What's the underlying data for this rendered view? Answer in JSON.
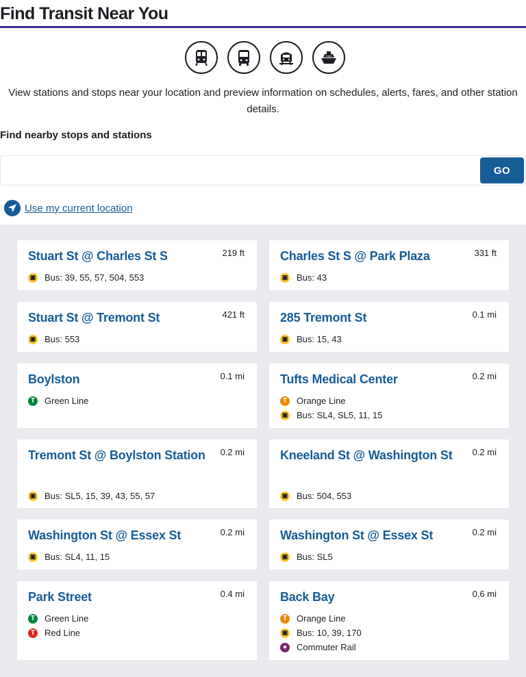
{
  "header": {
    "title": "Find Transit Near You"
  },
  "modes": [
    {
      "icon": "subway-icon"
    },
    {
      "icon": "bus-icon"
    },
    {
      "icon": "commuter-rail-icon"
    },
    {
      "icon": "ferry-icon"
    }
  ],
  "intro_text": "View stations and stops near your location and preview information on schedules, alerts, fares, and other station details.",
  "search": {
    "label": "Find nearby stops and stations",
    "value": "",
    "placeholder": "",
    "button_label": "GO"
  },
  "location_link": "Use my current location",
  "colors": {
    "accent": "#165c96",
    "rule": "#3b2f8f",
    "bus": "#ffc72c",
    "green_line": "#00843d",
    "orange_line": "#ed8b00",
    "red_line": "#da291c",
    "commuter_rail": "#80276c"
  },
  "stops": [
    {
      "name": "Stuart St @ Charles St S",
      "distance": "219 ft",
      "routes": [
        {
          "type": "bus",
          "label": "Bus: 39, 55, 57, 504, 553"
        }
      ]
    },
    {
      "name": "Charles St S @ Park Plaza",
      "distance": "331 ft",
      "routes": [
        {
          "type": "bus",
          "label": "Bus: 43"
        }
      ]
    },
    {
      "name": "Stuart St @ Tremont St",
      "distance": "421 ft",
      "routes": [
        {
          "type": "bus",
          "label": "Bus: 553"
        }
      ]
    },
    {
      "name": "285 Tremont St",
      "distance": "0.1 mi",
      "routes": [
        {
          "type": "bus",
          "label": "Bus: 15, 43"
        }
      ]
    },
    {
      "name": "Boylston",
      "distance": "0.1 mi",
      "routes": [
        {
          "type": "green",
          "label": "Green Line"
        }
      ]
    },
    {
      "name": "Tufts Medical Center",
      "distance": "0.2 mi",
      "routes": [
        {
          "type": "orange",
          "label": "Orange Line"
        },
        {
          "type": "bus",
          "label": "Bus: SL4, SL5, 11, 15"
        }
      ]
    },
    {
      "name": "Tremont St @ Boylston Station",
      "distance": "0.2 mi",
      "routes": [
        {
          "type": "bus",
          "label": "Bus: SL5, 15, 39, 43, 55, 57"
        }
      ]
    },
    {
      "name": "Kneeland St @ Washington St",
      "distance": "0.2 mi",
      "routes": [
        {
          "type": "bus",
          "label": "Bus: 504, 553"
        }
      ]
    },
    {
      "name": "Washington St @ Essex St",
      "distance": "0.2 mi",
      "routes": [
        {
          "type": "bus",
          "label": "Bus: SL4, 11, 15"
        }
      ]
    },
    {
      "name": "Washington St @ Essex St",
      "distance": "0.2 mi",
      "routes": [
        {
          "type": "bus",
          "label": "Bus: SL5"
        }
      ]
    },
    {
      "name": "Park Street",
      "distance": "0.4 mi",
      "routes": [
        {
          "type": "green",
          "label": "Green Line"
        },
        {
          "type": "red",
          "label": "Red Line"
        }
      ]
    },
    {
      "name": "Back Bay",
      "distance": "0.6 mi",
      "routes": [
        {
          "type": "orange",
          "label": "Orange Line"
        },
        {
          "type": "bus",
          "label": "Bus: 10, 39, 170"
        },
        {
          "type": "cr",
          "label": "Commuter Rail"
        }
      ]
    }
  ]
}
